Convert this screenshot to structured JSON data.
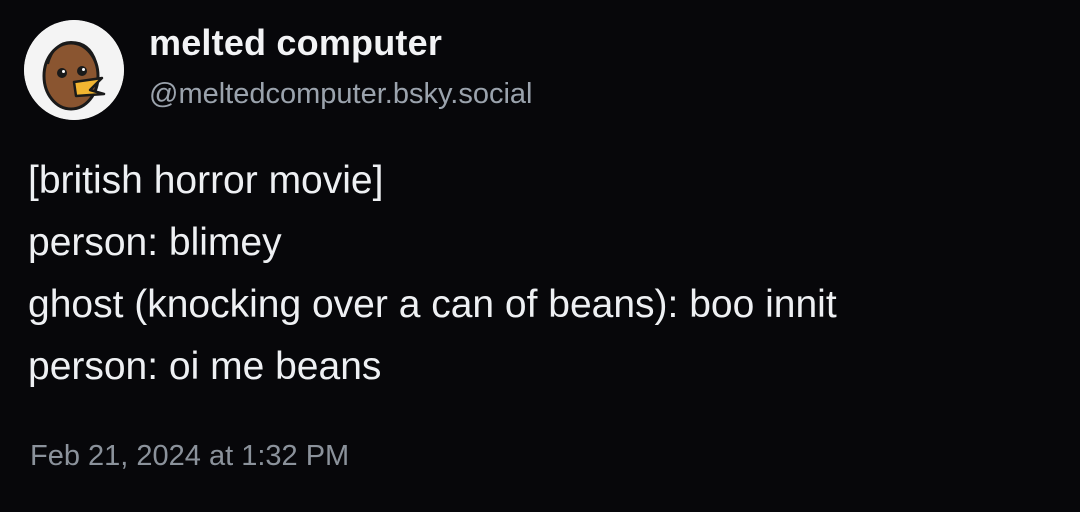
{
  "author": {
    "display_name": "melted computer",
    "handle": "@meltedcomputer.bsky.social",
    "avatar_icon": "cartoon-face-avatar-icon"
  },
  "post": {
    "lines": [
      "[british horror movie]",
      "person: blimey",
      "ghost (knocking over a can of beans): boo innit",
      "person: oi me beans"
    ],
    "timestamp": "Feb 21, 2024 at 1:32 PM"
  },
  "colors": {
    "background": "#07070a",
    "text": "#eef0f3",
    "muted": "#9ba3ad"
  }
}
